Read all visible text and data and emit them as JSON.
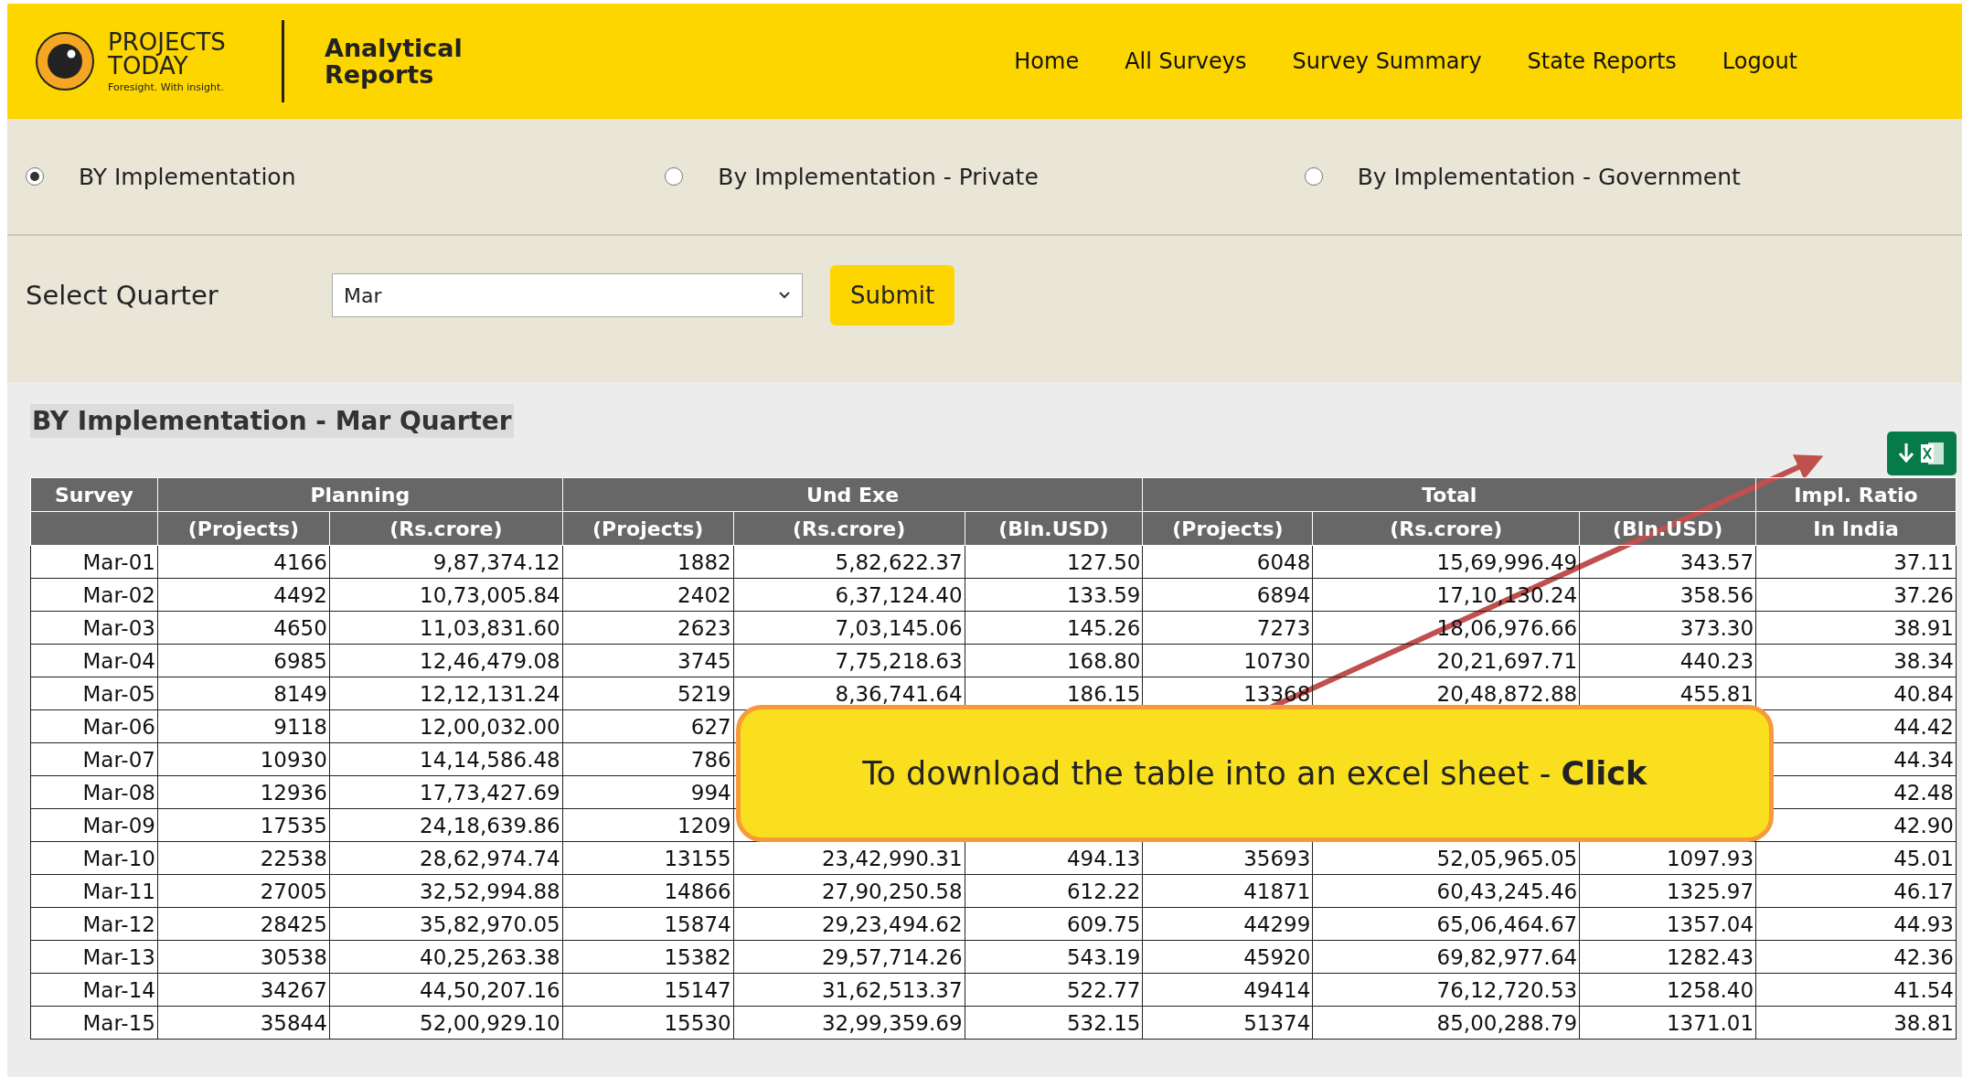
{
  "header": {
    "brand": "PROJECTS TODAY",
    "tagline": "Foresight. With insight.",
    "product": "Analytical Reports",
    "nav": [
      "Home",
      "All Surveys",
      "Survey Summary",
      "State Reports",
      "Logout"
    ]
  },
  "report_types": [
    {
      "label": "BY Implementation",
      "selected": true
    },
    {
      "label": "By Implementation - Private",
      "selected": false
    },
    {
      "label": "By Implementation - Government",
      "selected": false
    }
  ],
  "quarter": {
    "label": "Select Quarter",
    "value": "Mar",
    "submit": "Submit"
  },
  "report_title": "BY Implementation - Mar Quarter",
  "table": {
    "groups": [
      "Survey",
      "Planning",
      "Und Exe",
      "Total",
      "Impl. Ratio"
    ],
    "subheaders": [
      "(Projects)",
      "(Rs.crore)",
      "(Projects)",
      "(Rs.crore)",
      "(Bln.USD)",
      "(Projects)",
      "(Rs.crore)",
      "(Bln.USD)",
      "In India"
    ],
    "rows": [
      [
        "Mar-01",
        "4166",
        "9,87,374.12",
        "1882",
        "5,82,622.37",
        "127.50",
        "6048",
        "15,69,996.49",
        "343.57",
        "37.11"
      ],
      [
        "Mar-02",
        "4492",
        "10,73,005.84",
        "2402",
        "6,37,124.40",
        "133.59",
        "6894",
        "17,10,130.24",
        "358.56",
        "37.26"
      ],
      [
        "Mar-03",
        "4650",
        "11,03,831.60",
        "2623",
        "7,03,145.06",
        "145.26",
        "7273",
        "18,06,976.66",
        "373.30",
        "38.91"
      ],
      [
        "Mar-04",
        "6985",
        "12,46,479.08",
        "3745",
        "7,75,218.63",
        "168.80",
        "10730",
        "20,21,697.71",
        "440.23",
        "38.34"
      ],
      [
        "Mar-05",
        "8149",
        "12,12,131.24",
        "5219",
        "8,36,741.64",
        "186.15",
        "13368",
        "20,48,872.88",
        "455.81",
        "40.84"
      ],
      [
        "Mar-06",
        "9118",
        "12,00,032.00",
        "627",
        null,
        null,
        null,
        null,
        null,
        "44.42"
      ],
      [
        "Mar-07",
        "10930",
        "14,14,586.48",
        "786",
        null,
        null,
        null,
        null,
        null,
        "44.34"
      ],
      [
        "Mar-08",
        "12936",
        "17,73,427.69",
        "994",
        null,
        null,
        null,
        null,
        null,
        "42.48"
      ],
      [
        "Mar-09",
        "17535",
        "24,18,639.86",
        "1209",
        null,
        null,
        null,
        null,
        null,
        "42.90"
      ],
      [
        "Mar-10",
        "22538",
        "28,62,974.74",
        "13155",
        "23,42,990.31",
        "494.13",
        "35693",
        "52,05,965.05",
        "1097.93",
        "45.01"
      ],
      [
        "Mar-11",
        "27005",
        "32,52,994.88",
        "14866",
        "27,90,250.58",
        "612.22",
        "41871",
        "60,43,245.46",
        "1325.97",
        "46.17"
      ],
      [
        "Mar-12",
        "28425",
        "35,82,970.05",
        "15874",
        "29,23,494.62",
        "609.75",
        "44299",
        "65,06,464.67",
        "1357.04",
        "44.93"
      ],
      [
        "Mar-13",
        "30538",
        "40,25,263.38",
        "15382",
        "29,57,714.26",
        "543.19",
        "45920",
        "69,82,977.64",
        "1282.43",
        "42.36"
      ],
      [
        "Mar-14",
        "34267",
        "44,50,207.16",
        "15147",
        "31,62,513.37",
        "522.77",
        "49414",
        "76,12,720.53",
        "1258.40",
        "41.54"
      ],
      [
        "Mar-15",
        "35844",
        "52,00,929.10",
        "15530",
        "32,99,359.69",
        "532.15",
        "51374",
        "85,00,288.79",
        "1371.01",
        "38.81"
      ]
    ]
  },
  "callout": {
    "text": "To download the table into an excel sheet - **Click**"
  }
}
